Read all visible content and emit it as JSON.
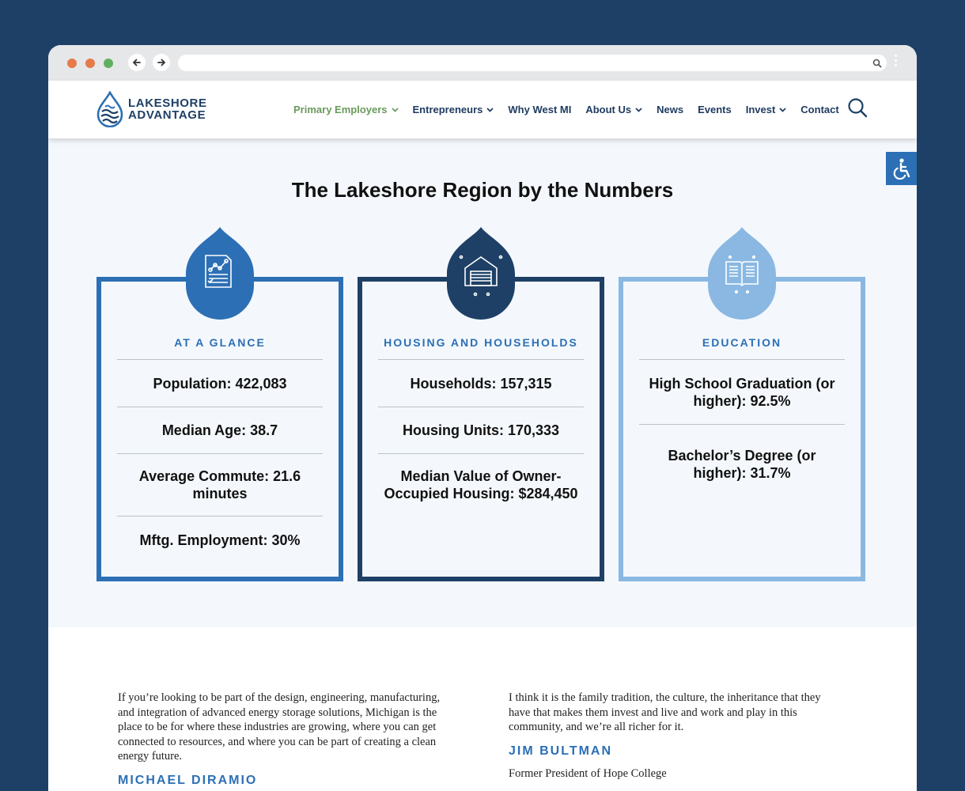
{
  "colors": {
    "page_bg": "#1e4066",
    "brand_dark": "#1e4066",
    "brand_mid": "#2c6fb5",
    "brand_light": "#8ab8e2",
    "nav_active": "#6a9a5c"
  },
  "window": {
    "traffic_lights": [
      "#e67a4a",
      "#e67a4a",
      "#61b061"
    ],
    "back_icon": "arrow-left-icon",
    "forward_icon": "arrow-right-icon",
    "url_value": ""
  },
  "logo": {
    "line1": "LAKESHORE",
    "line2": "ADVANTAGE"
  },
  "nav": [
    {
      "label": "Primary Employers",
      "dropdown": true,
      "active": true
    },
    {
      "label": "Entrepreneurs",
      "dropdown": true
    },
    {
      "label": "Why West MI",
      "dropdown": false
    },
    {
      "label": "About Us",
      "dropdown": true
    },
    {
      "label": "News",
      "dropdown": false
    },
    {
      "label": "Events",
      "dropdown": false
    },
    {
      "label": "Invest",
      "dropdown": true
    },
    {
      "label": "Contact",
      "dropdown": false
    }
  ],
  "stats": {
    "title": "The Lakeshore Region by the Numbers",
    "cards": [
      {
        "title": "AT A GLANCE",
        "icon": "report-chart-icon",
        "color": "#2c6fb5",
        "items": [
          "Population: 422,083",
          "Median Age: 38.7",
          "Average Commute: 21.6 minutes",
          "Mftg. Employment: 30%"
        ]
      },
      {
        "title": "HOUSING AND HOUSEHOLDS",
        "icon": "house-icon",
        "color": "#1e4066",
        "items": [
          "Households: 157,315",
          "Housing Units: 170,333",
          "Median Value of Owner-Occupied Housing: $284,450"
        ]
      },
      {
        "title": "EDUCATION",
        "icon": "book-icon",
        "color": "#8ab8e2",
        "items": [
          "High School Graduation (or higher): 92.5%",
          "Bachelor’s Degree (or higher): 31.7%"
        ]
      }
    ]
  },
  "quotes": [
    {
      "text": "If you’re looking to be part of the design, engineering, manufacturing, and integration of advanced energy storage solutions, Michigan is the place to be for where these industries are growing, where you can get connected to resources, and where you can be part of creating a clean energy future.",
      "name": "MICHAEL DIRAMIO",
      "role": ""
    },
    {
      "text": "I think it is the family tradition, the culture, the inheritance that they have that makes them invest and live and work and play in this community, and we’re all richer for it.",
      "name": "JIM BULTMAN",
      "role": "Former President of Hope College"
    }
  ]
}
